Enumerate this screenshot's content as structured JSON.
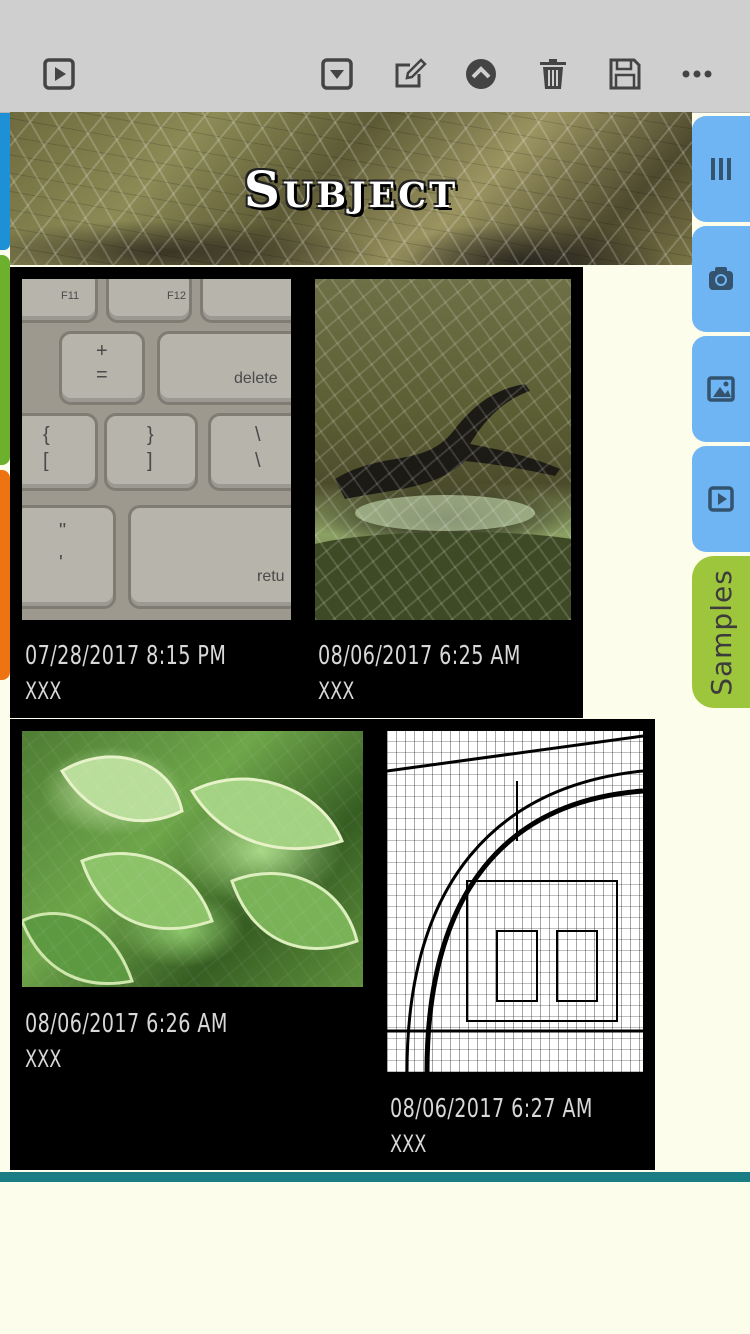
{
  "toolbar": {
    "icons": [
      "play-box-icon",
      "dropdown-box-icon",
      "edit-icon",
      "chevron-up-circle-icon",
      "trash-icon",
      "save-icon",
      "more-icon"
    ]
  },
  "header": {
    "title": "Subject"
  },
  "side_tabs": {
    "items": [
      "columns-icon",
      "camera-icon",
      "photo-frame-icon",
      "play-box-icon"
    ],
    "samples_label": "Samples"
  },
  "cards": [
    {
      "date": "07/28/2017  8:15 PM",
      "caption": "XXX",
      "photo": "keyboard"
    },
    {
      "date": "08/06/2017  6:25 AM",
      "caption": "XXX",
      "photo": "tree mosaic"
    },
    {
      "date": "08/06/2017  6:26 AM",
      "caption": "XXX",
      "photo": "green leaves"
    },
    {
      "date": "08/06/2017  6:27 AM",
      "caption": "XXX",
      "photo": "building sketch"
    }
  ],
  "keyboard": {
    "keys": [
      "F11",
      "F12",
      "+",
      "=",
      "delete",
      "{",
      "[",
      "}",
      "]",
      "\\",
      "\\",
      "\"",
      "'",
      "retu"
    ]
  },
  "colors": {
    "toolbar": "#cfcfcf",
    "banner_title": "#ffffff",
    "side_tab": "#6fb4f3",
    "samples_tab": "#9ec63c",
    "edge_blue": "#1e90d6",
    "edge_green": "#6cb02e",
    "edge_orange": "#ee7411",
    "bottom_rule": "#1b7d84",
    "background": "#fdfdec"
  }
}
